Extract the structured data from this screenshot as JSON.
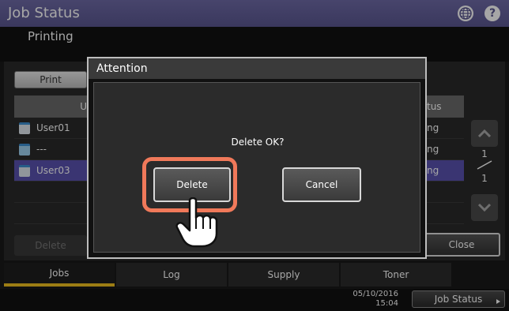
{
  "header": {
    "title": "Job Status",
    "subtitle": "Printing",
    "globe_icon": "globe-icon",
    "help_icon": "help-icon",
    "help_glyph": "?",
    "accent_color": "#5a5690"
  },
  "background": {
    "print_tab_label": "Print",
    "column_user_label": "U",
    "column_status_label": "tus",
    "rows": [
      {
        "user": "User01",
        "status": "ng",
        "icon": "printer-icon",
        "selected": false
      },
      {
        "user": "---",
        "status": "ng",
        "icon": "copier-icon",
        "selected": false
      },
      {
        "user": "User03",
        "status": "ng",
        "icon": "printer-icon",
        "selected": true
      }
    ],
    "delete_label": "Delete",
    "close_label": "Close",
    "page_current": "1",
    "page_total": "1"
  },
  "tabs": [
    {
      "label": "Jobs",
      "active": true
    },
    {
      "label": "Log",
      "active": false
    },
    {
      "label": "Supply",
      "active": false
    },
    {
      "label": "Toner",
      "active": false
    }
  ],
  "footer": {
    "date": "05/10/2016",
    "time": "15:04",
    "job_status_label": "Job Status"
  },
  "dialog": {
    "title": "Attention",
    "message": "Delete OK?",
    "delete_label": "Delete",
    "cancel_label": "Cancel",
    "highlight_color": "#f0795a"
  }
}
